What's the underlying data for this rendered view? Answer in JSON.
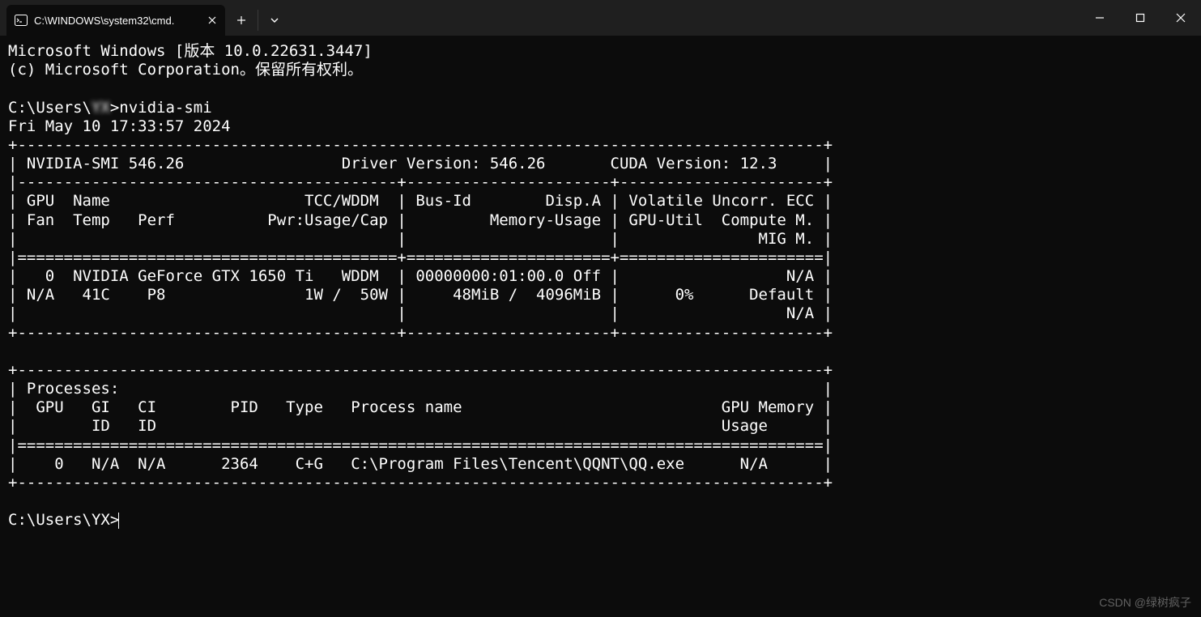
{
  "titlebar": {
    "tab_title": "C:\\WINDOWS\\system32\\cmd."
  },
  "terminal": {
    "banner_line1": "Microsoft Windows [版本 10.0.22631.3447]",
    "banner_line2": "(c) Microsoft Corporation。保留所有权利。",
    "prompt1_prefix": "C:\\Users\\",
    "prompt1_blur": "YX",
    "prompt1_suffix": ">",
    "command": "nvidia-smi",
    "timestamp": "Fri May 10 17:33:57 2024",
    "nvsmi_top_border": "+---------------------------------------------------------------------------------------+",
    "nvsmi_header": "| NVIDIA-SMI 546.26                 Driver Version: 546.26       CUDA Version: 12.3     |",
    "nvsmi_sep": "|-----------------------------------------+----------------------+----------------------+",
    "nvsmi_col1": "| GPU  Name                     TCC/WDDM  | Bus-Id        Disp.A | Volatile Uncorr. ECC |",
    "nvsmi_col2": "| Fan  Temp   Perf          Pwr:Usage/Cap |         Memory-Usage | GPU-Util  Compute M. |",
    "nvsmi_col3": "|                                         |                      |               MIG M. |",
    "nvsmi_eq": "|=========================================+======================+======================|",
    "nvsmi_row1": "|   0  NVIDIA GeForce GTX 1650 Ti   WDDM  | 00000000:01:00.0 Off |                  N/A |",
    "nvsmi_row2": "| N/A   41C    P8               1W /  50W |     48MiB /  4096MiB |      0%      Default |",
    "nvsmi_row3": "|                                         |                      |                  N/A |",
    "nvsmi_bot": "+-----------------------------------------+----------------------+----------------------+",
    "blank": "",
    "proc_top": "+---------------------------------------------------------------------------------------+",
    "proc_hdr": "| Processes:                                                                            |",
    "proc_col1": "|  GPU   GI   CI        PID   Type   Process name                            GPU Memory |",
    "proc_col2": "|        ID   ID                                                             Usage      |",
    "proc_eq": "|=======================================================================================|",
    "proc_row": "|    0   N/A  N/A      2364    C+G   C:\\Program Files\\Tencent\\QQNT\\QQ.exe      N/A      |",
    "proc_bot": "+---------------------------------------------------------------------------------------+",
    "prompt2": "C:\\Users\\YX>"
  },
  "watermark": "CSDN @绿树疯子"
}
